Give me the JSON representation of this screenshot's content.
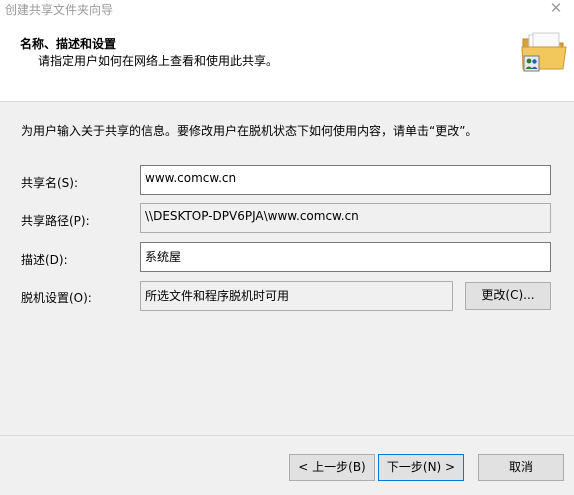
{
  "window": {
    "title": "创建共享文件夹向导",
    "close_glyph": "✕"
  },
  "header": {
    "title": "名称、描述和设置",
    "subtitle": "请指定用户如何在网络上查看和使用此共享。"
  },
  "intro": "为用户输入关于共享的信息。要修改用户在脱机状态下如何使用内容，请单击“更改”。",
  "form": {
    "share_name": {
      "label": "共享名(S):",
      "value": "www.comcw.cn"
    },
    "share_path": {
      "label": "共享路径(P):",
      "value": "\\\\DESKTOP-DPV6PJA\\www.comcw.cn"
    },
    "description": {
      "label": "描述(D):",
      "value": "系统屋"
    },
    "offline": {
      "label": "脱机设置(O):",
      "value": "所选文件和程序脱机时可用",
      "change_label": "更改(C)..."
    }
  },
  "footer": {
    "back_label": "< 上一步(B)",
    "next_label": "下一步(N) >",
    "cancel_label": "取消"
  },
  "colors": {
    "accent": "#0078d7",
    "folder": "#e8b64a"
  },
  "icons": {
    "header": "shared-folder-icon",
    "close": "close-icon"
  }
}
